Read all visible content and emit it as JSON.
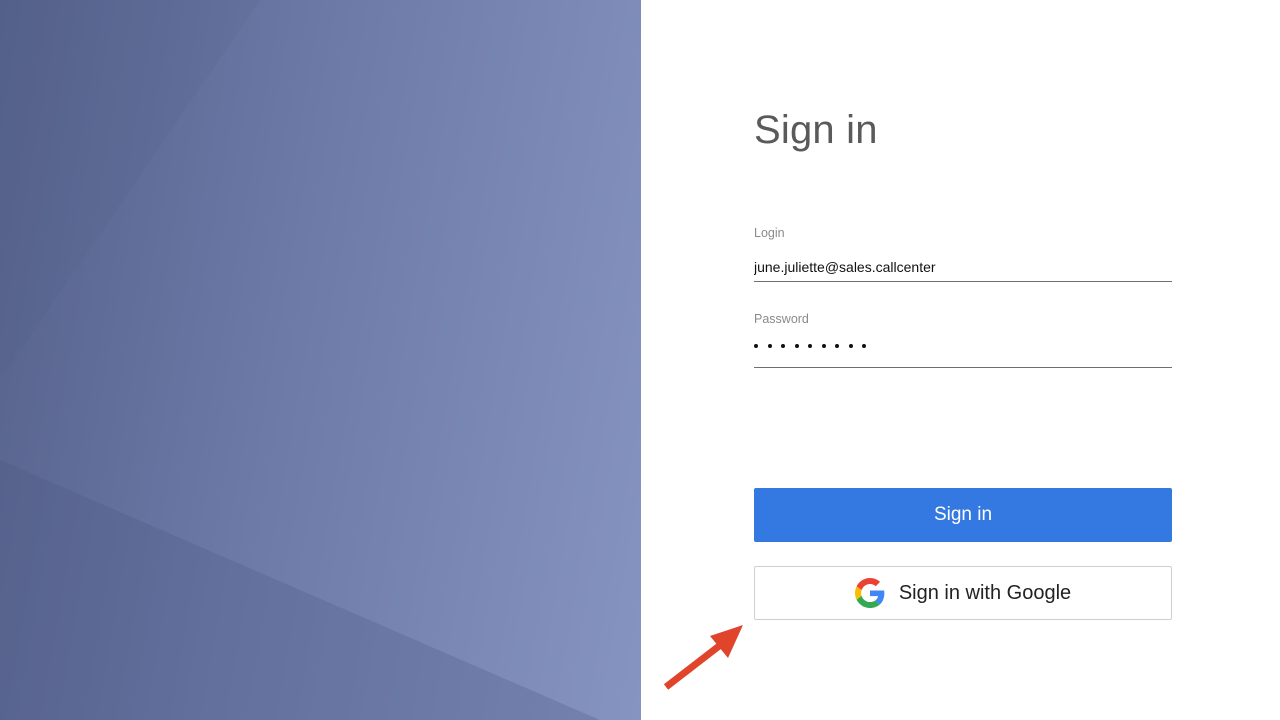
{
  "signin": {
    "title": "Sign in",
    "login_label": "Login",
    "login_value": "june.juliette@sales.callcenter",
    "password_label": "Password",
    "password_length": 9,
    "submit_label": "Sign in",
    "google_label": "Sign in with Google"
  },
  "colors": {
    "primary_button": "#3478e1",
    "annotation_arrow": "#e0452c",
    "title_text": "#5a5a5a"
  },
  "icons": {
    "google": "google-g-icon",
    "arrow": "red-arrow-annotation"
  }
}
